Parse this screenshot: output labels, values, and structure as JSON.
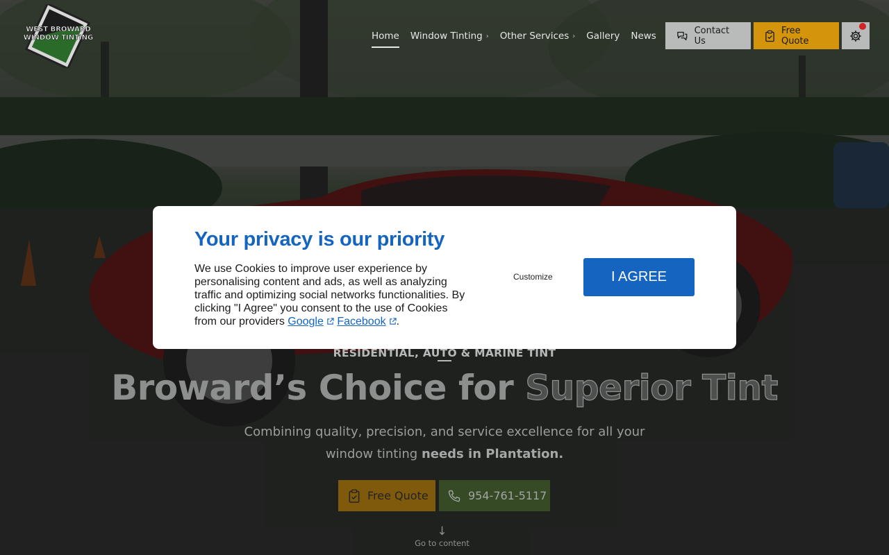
{
  "brand": {
    "logo_text_line1": "WEST BROWARD",
    "logo_text_line2": "WINDOW TINTING",
    "logo_icon": "tinted-window-logo"
  },
  "nav": {
    "items": [
      {
        "label": "Home",
        "active": true,
        "has_submenu": false
      },
      {
        "label": "Window Tinting",
        "active": false,
        "has_submenu": true
      },
      {
        "label": "Other Services",
        "active": false,
        "has_submenu": true
      },
      {
        "label": "Gallery",
        "active": false,
        "has_submenu": false
      },
      {
        "label": "News",
        "active": false,
        "has_submenu": false
      }
    ],
    "submenu_icon": "chevron-right-icon"
  },
  "header_actions": {
    "contact_label": "Contact Us",
    "contact_icon": "chat-bubbles-icon",
    "quote_label": "Free Quote",
    "quote_icon": "clipboard-check-icon",
    "settings_icon": "gear-icon",
    "notification_dot_color": "#d02323"
  },
  "hero": {
    "eyebrow": "RESIDENTIAL, AUTO & MARINE TINT",
    "headline_part1": "Broward’s Choice for",
    "headline_part2": "Superior Tint",
    "subtext_regular": "Combining quality, precision, and service excellence for all your window tinting",
    "subtext_bold": "needs in Plantation.",
    "cta_quote_label": "Free Quote",
    "cta_phone_label": "954-761-5117",
    "scroll_label": "Go to content",
    "scroll_arrow": "↓"
  },
  "cookie_modal": {
    "title": "Your privacy is our priority",
    "body": "We use Cookies to improve user experience by personalising content and ads, as well as analyzing traffic and optimizing social networks functionalities. By clicking \"I Agree\" you consent to the use of Cookies from our providers",
    "providers": [
      "Google",
      "Facebook"
    ],
    "body_end": ".",
    "customize_label": "Customize",
    "agree_label": "I AGREE",
    "accent_color": "#1565c0"
  },
  "colors": {
    "quote_orange": "#d4950d",
    "phone_green": "#354a25",
    "header_gray_button": "#b9bbba"
  }
}
